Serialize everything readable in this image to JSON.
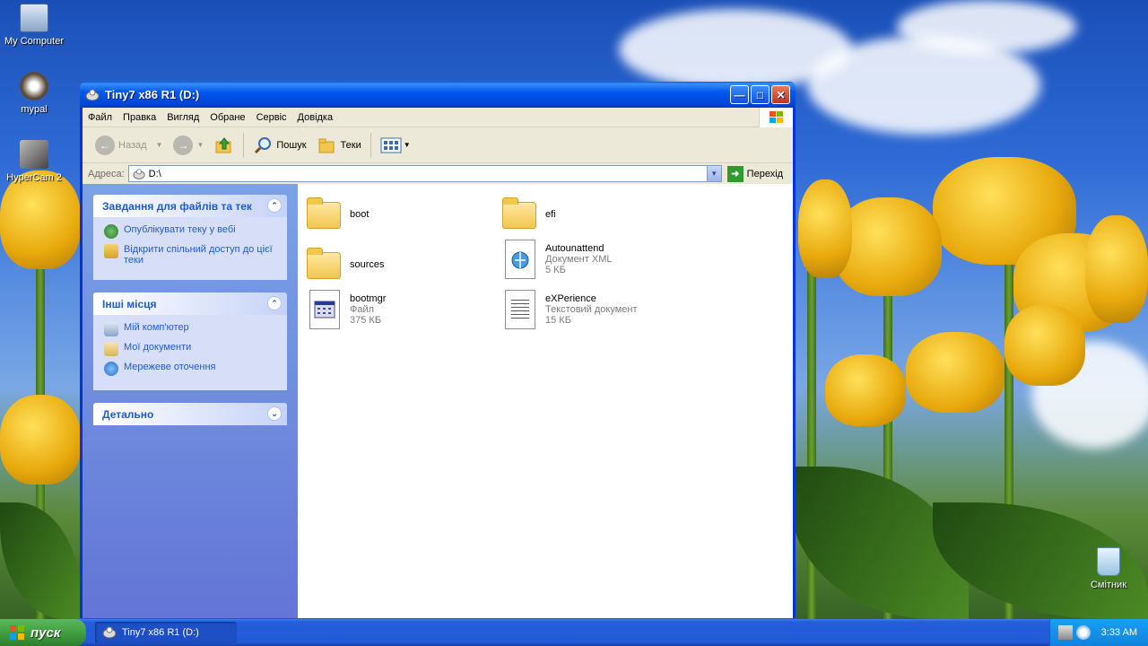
{
  "desktop": {
    "icons": [
      {
        "label": "My Computer"
      },
      {
        "label": "mypal"
      },
      {
        "label": "HyperCam 2"
      },
      {
        "label": "Смітник"
      }
    ]
  },
  "window": {
    "title": "Tiny7 x86 R1 (D:)",
    "menu": [
      "Файл",
      "Правка",
      "Вигляд",
      "Обране",
      "Сервіс",
      "Довідка"
    ],
    "toolbar": {
      "back": "Назад",
      "search": "Пошук",
      "folders": "Теки"
    },
    "address": {
      "label": "Адреса:",
      "value": "D:\\",
      "go": "Перехід"
    },
    "taskpane": {
      "tasks_title": "Завдання для файлів та тек",
      "tasks": [
        "Опублікувати теку у вебі",
        "Відкрити спільний доступ до цієї теки"
      ],
      "places_title": "Інші місця",
      "places": [
        "Мій комп'ютер",
        "Мої документи",
        "Мережеве оточення"
      ],
      "details_title": "Детально"
    },
    "files": [
      {
        "name": "boot",
        "type": "",
        "size": ""
      },
      {
        "name": "efi",
        "type": "",
        "size": ""
      },
      {
        "name": "sources",
        "type": "",
        "size": ""
      },
      {
        "name": "Autounattend",
        "type": "Документ XML",
        "size": "5 КБ"
      },
      {
        "name": "bootmgr",
        "type": "Файл",
        "size": "375 КБ"
      },
      {
        "name": "eXPerience",
        "type": "Текстовий документ",
        "size": "15 КБ"
      }
    ]
  },
  "taskbar": {
    "start": "пуск",
    "task_button": "Tiny7 x86 R1 (D:)",
    "clock": "3:33 AM"
  }
}
